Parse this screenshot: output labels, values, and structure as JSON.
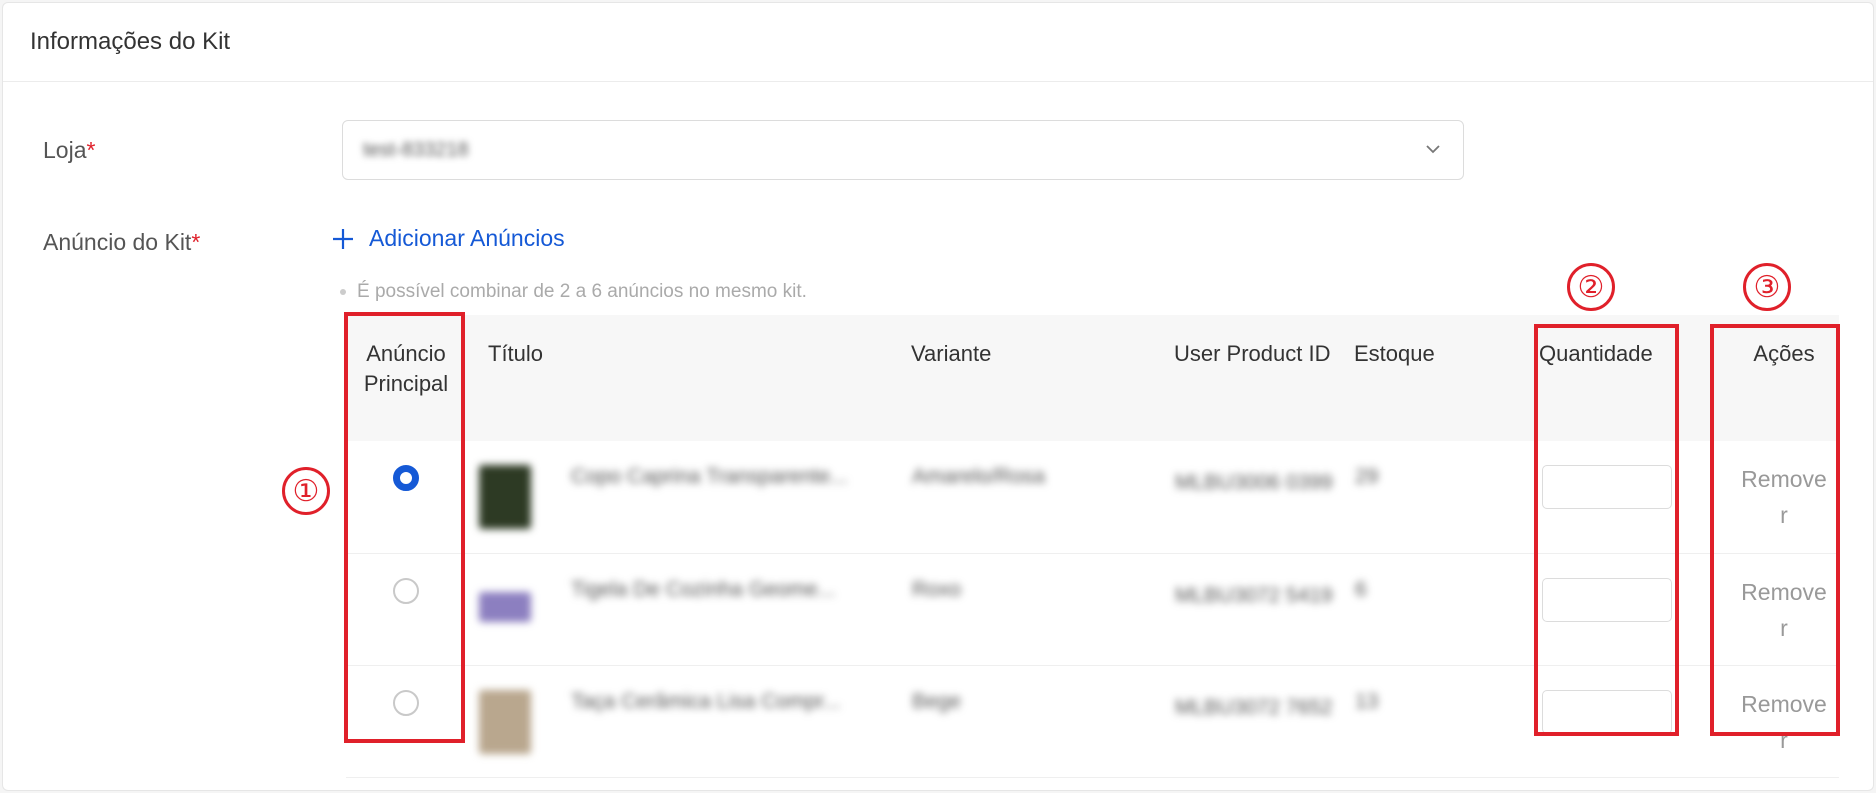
{
  "header": {
    "title": "Informações do Kit"
  },
  "form": {
    "store_label": "Loja",
    "store_value": "test-833218",
    "kit_label": "Anúncio do Kit",
    "required_mark": "*",
    "add_label": "Adicionar Anúncios",
    "hint": "É possível combinar de 2 a 6 anúncios no mesmo kit."
  },
  "table": {
    "headers": {
      "main": "Anúncio Principal",
      "title": "Título",
      "variant": "Variante",
      "user_product_id": "User Product ID",
      "stock": "Estoque",
      "quantity": "Quantidade",
      "actions": "Ações"
    },
    "rows": [
      {
        "selected": true,
        "title": "Copo Caprina Transparente...",
        "variant": "Amarelo/Rosa",
        "upid": "MLBU3006 0399",
        "stock": "29",
        "quantity": "",
        "action": "Remover",
        "thumb_color": "#2d3a24"
      },
      {
        "selected": false,
        "title": "Tigela De Cozinha Geome...",
        "variant": "Roxo",
        "upid": "MLBU3072 5419",
        "stock": "6",
        "quantity": "",
        "action": "Remover",
        "thumb_color": "#8c7fc0"
      },
      {
        "selected": false,
        "title": "Taça Cerâmica Lisa Compr...",
        "variant": "Bege",
        "upid": "MLBU3072 7652",
        "stock": "13",
        "quantity": "",
        "action": "Remover",
        "thumb_color": "#b9a78e"
      }
    ]
  },
  "annotations": {
    "one": "①",
    "two": "②",
    "three": "③"
  },
  "colors": {
    "accent": "#1559d6",
    "highlight": "#e0202a"
  }
}
